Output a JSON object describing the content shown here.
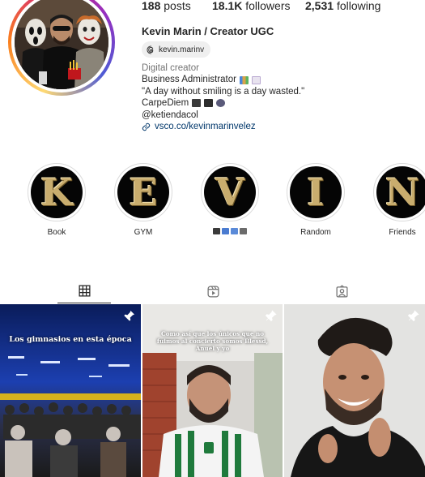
{
  "profile": {
    "stats": {
      "posts_count": "188",
      "posts_label": "posts",
      "followers_count": "18.1K",
      "followers_label": "followers",
      "following_count": "2,531",
      "following_label": "following"
    },
    "full_name": "Kevin Marin / Creator UGC",
    "threads_handle": "kevin.marinv",
    "category": "Digital creator",
    "bio_lines": [
      "Business Administrator",
      "\"A day without smiling is a day wasted.\"",
      "CarpeDiem",
      "@ketiendacol"
    ],
    "link": "vsco.co/kevinmarinvelez"
  },
  "highlights": [
    {
      "letter": "K",
      "label": "Book"
    },
    {
      "letter": "E",
      "label": "GYM"
    },
    {
      "letter": "V",
      "label": "",
      "emoji_label": [
        "#3a3a3a",
        "#4a7bd0",
        "#5a8ad8",
        "#6b6b6b"
      ]
    },
    {
      "letter": "I",
      "label": "Random"
    },
    {
      "letter": "N",
      "label": "Friends"
    }
  ],
  "tabs": [
    {
      "name": "posts",
      "icon": "grid-icon",
      "active": true
    },
    {
      "name": "reels",
      "icon": "reels-icon",
      "active": false
    },
    {
      "name": "tagged",
      "icon": "tagged-icon",
      "active": false
    }
  ],
  "posts": [
    {
      "caption": "Los gimnasios en esta época",
      "pinned": true
    },
    {
      "caption": "Como así que los únicos que no fuimos al concierto somos Blessd, Anuel y yo",
      "pinned": true
    },
    {
      "caption": "",
      "pinned": true
    }
  ],
  "colors": {
    "link": "#00376b",
    "muted": "#737373",
    "highlight_gold": "#c9ad6e"
  }
}
